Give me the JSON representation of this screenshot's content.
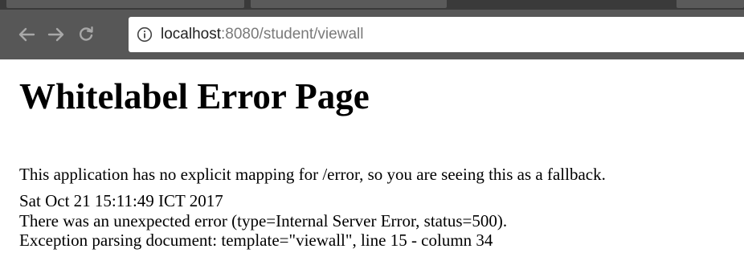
{
  "browser": {
    "url_host": "localhost",
    "url_rest": ":8080/student/viewall",
    "icons": {
      "back": "back-arrow-icon",
      "forward": "forward-arrow-icon",
      "reload": "reload-icon",
      "info": "info-icon"
    }
  },
  "page": {
    "title": "Whitelabel Error Page",
    "message": "This application has no explicit mapping for /error, so you are seeing this as a fallback.",
    "timestamp": "Sat Oct 21 15:11:49 ICT 2017",
    "error_line": "There was an unexpected error (type=Internal Server Error, status=500).",
    "exception_line": "Exception parsing document: template=\"viewall\", line 15 - column 34"
  }
}
